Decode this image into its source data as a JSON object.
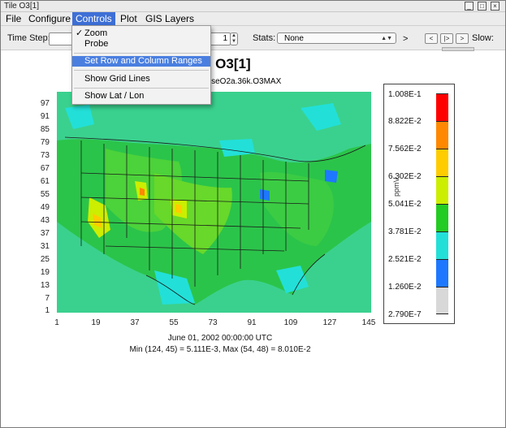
{
  "window": {
    "title": "Tile O3[1]"
  },
  "menubar": {
    "items": [
      "File",
      "Configure",
      "Controls",
      "Plot",
      "GIS Layers"
    ]
  },
  "toolbar": {
    "time_step_label": "Time Step:",
    "layer_value": "1",
    "stats_label": "Stats:",
    "stats_value": "None",
    "arrow_label": ">",
    "nav_buttons": [
      "<",
      "|>",
      ">"
    ],
    "slow_label": "Slow:"
  },
  "controls_menu": {
    "items": [
      {
        "label": "Zoom",
        "checked": true
      },
      {
        "label": "Probe",
        "checked": false
      },
      {
        "label": "Set Row and Column Ranges",
        "highlighted": true
      },
      {
        "label": "Show Grid Lines"
      },
      {
        "label": "Show Lat / Lon"
      }
    ]
  },
  "plot": {
    "title": "1 O3[1]",
    "subtitle": "baseO2a.36k.O3MAX",
    "y_ticks": [
      "97",
      "91",
      "85",
      "79",
      "73",
      "67",
      "61",
      "55",
      "49",
      "43",
      "37",
      "31",
      "25",
      "19",
      "13",
      "7",
      "1"
    ],
    "x_ticks": [
      "1",
      "19",
      "37",
      "55",
      "73",
      "91",
      "109",
      "127",
      "145"
    ],
    "date": "June 01, 2002 00:00:00 UTC",
    "minmax": "Min (124, 45) = 5.111E-3, Max (54, 48) = 8.010E-2"
  },
  "legend": {
    "unit": "ppmV",
    "labels": [
      "1.008E-1",
      "8.822E-2",
      "7.562E-2",
      "6.302E-2",
      "5.041E-2",
      "3.781E-2",
      "2.521E-2",
      "1.260E-2",
      "2.790E-7"
    ],
    "colors": [
      "#ff0000",
      "#ff8800",
      "#ffcc00",
      "#ccee00",
      "#22cc22",
      "#22e0d8",
      "#1e78ff",
      "#d8d8d8"
    ]
  },
  "colors": {
    "accent": "#3d6fd6",
    "map_base": "#3ad18e"
  }
}
